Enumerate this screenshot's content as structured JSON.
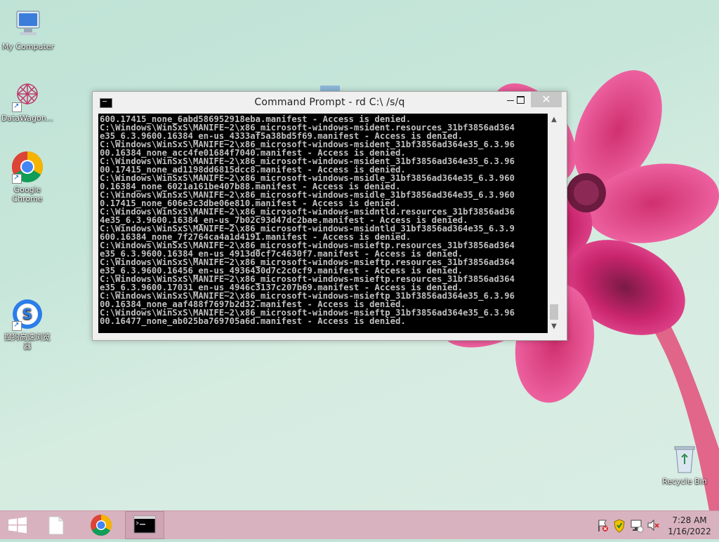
{
  "desktop": {
    "icons": [
      {
        "label": "My Computer",
        "icon": "computer-icon"
      },
      {
        "label": "DataWagon...",
        "icon": "datawagon-icon"
      },
      {
        "label": "Google Chrome",
        "icon": "chrome-icon"
      },
      {
        "label": "搜狗高速浏览器",
        "icon": "sogou-browser-icon"
      },
      {
        "label": "Recycle Bin",
        "icon": "recycle-bin-icon"
      }
    ]
  },
  "window": {
    "title": "Command Prompt - rd  C:\\ /s/q",
    "close_glyph": "✕",
    "console_lines": [
      "600.17415_none_6abd586952918eba.manifest - Access is denied.",
      "C:\\Windows\\WinSxS\\MANIFE~2\\x86_microsoft-windows-msident.resources_31bf3856ad364",
      "e35_6.3.9600.16384_en-us_4333af5a38bd5f69.manifest - Access is denied.",
      "C:\\Windows\\WinSxS\\MANIFE~2\\x86_microsoft-windows-msident_31bf3856ad364e35_6.3.96",
      "00.16384_none_acc4fe01684f7040.manifest - Access is denied.",
      "C:\\Windows\\WinSxS\\MANIFE~2\\x86_microsoft-windows-msident_31bf3856ad364e35_6.3.96",
      "00.17415_none_ad1198dd6815dcc8.manifest - Access is denied.",
      "C:\\Windows\\WinSxS\\MANIFE~2\\x86_microsoft-windows-msidle_31bf3856ad364e35_6.3.960",
      "0.16384_none_6021a161be407b88.manifest - Access is denied.",
      "C:\\Windows\\WinSxS\\MANIFE~2\\x86_microsoft-windows-msidle_31bf3856ad364e35_6.3.960",
      "0.17415_none_606e3c3dbe06e810.manifest - Access is denied.",
      "C:\\Windows\\WinSxS\\MANIFE~2\\x86_microsoft-windows-msidntld.resources_31bf3856ad36",
      "4e35_6.3.9600.16384_en-us_7b02c93d47dc2bae.manifest - Access is denied.",
      "C:\\Windows\\WinSxS\\MANIFE~2\\x86_microsoft-windows-msidntld_31bf3856ad364e35_6.3.9",
      "600.16384_none_7f2764ca4a1d4191.manifest - Access is denied.",
      "C:\\Windows\\WinSxS\\MANIFE~2\\x86_microsoft-windows-msieftp.resources_31bf3856ad364",
      "e35_6.3.9600.16384_en-us_4913d0cf7c4630f7.manifest - Access is denied.",
      "C:\\Windows\\WinSxS\\MANIFE~2\\x86_microsoft-windows-msieftp.resources_31bf3856ad364",
      "e35_6.3.9600.16456_en-us_4936430d7c2c0cf9.manifest - Access is denied.",
      "C:\\Windows\\WinSxS\\MANIFE~2\\x86_microsoft-windows-msieftp.resources_31bf3856ad364",
      "e35_6.3.9600.17031_en-us_4946c3137c207b69.manifest - Access is denied.",
      "C:\\Windows\\WinSxS\\MANIFE~2\\x86_microsoft-windows-msieftp_31bf3856ad364e35_6.3.96",
      "00.16384_none_aaf488f7697b2d32.manifest - Access is denied.",
      "C:\\Windows\\WinSxS\\MANIFE~2\\x86_microsoft-windows-msieftp_31bf3856ad364e35_6.3.96",
      "00.16477_none_ab025ba769705a6d.manifest - Access is denied."
    ]
  },
  "taskbar": {
    "items": [
      "start-icon",
      "file-icon",
      "chrome-icon",
      "command-prompt-icon"
    ],
    "tray_icons": [
      "action-center-flag-icon",
      "security-shield-icon",
      "network-icon",
      "volume-muted-icon"
    ],
    "time": "7:28 AM",
    "date": "1/16/2022"
  },
  "colors": {
    "taskbar": "#d8b3bf",
    "console_bg": "#000000",
    "console_text": "#c0c0c0",
    "close_button": "#c7c7c7"
  }
}
